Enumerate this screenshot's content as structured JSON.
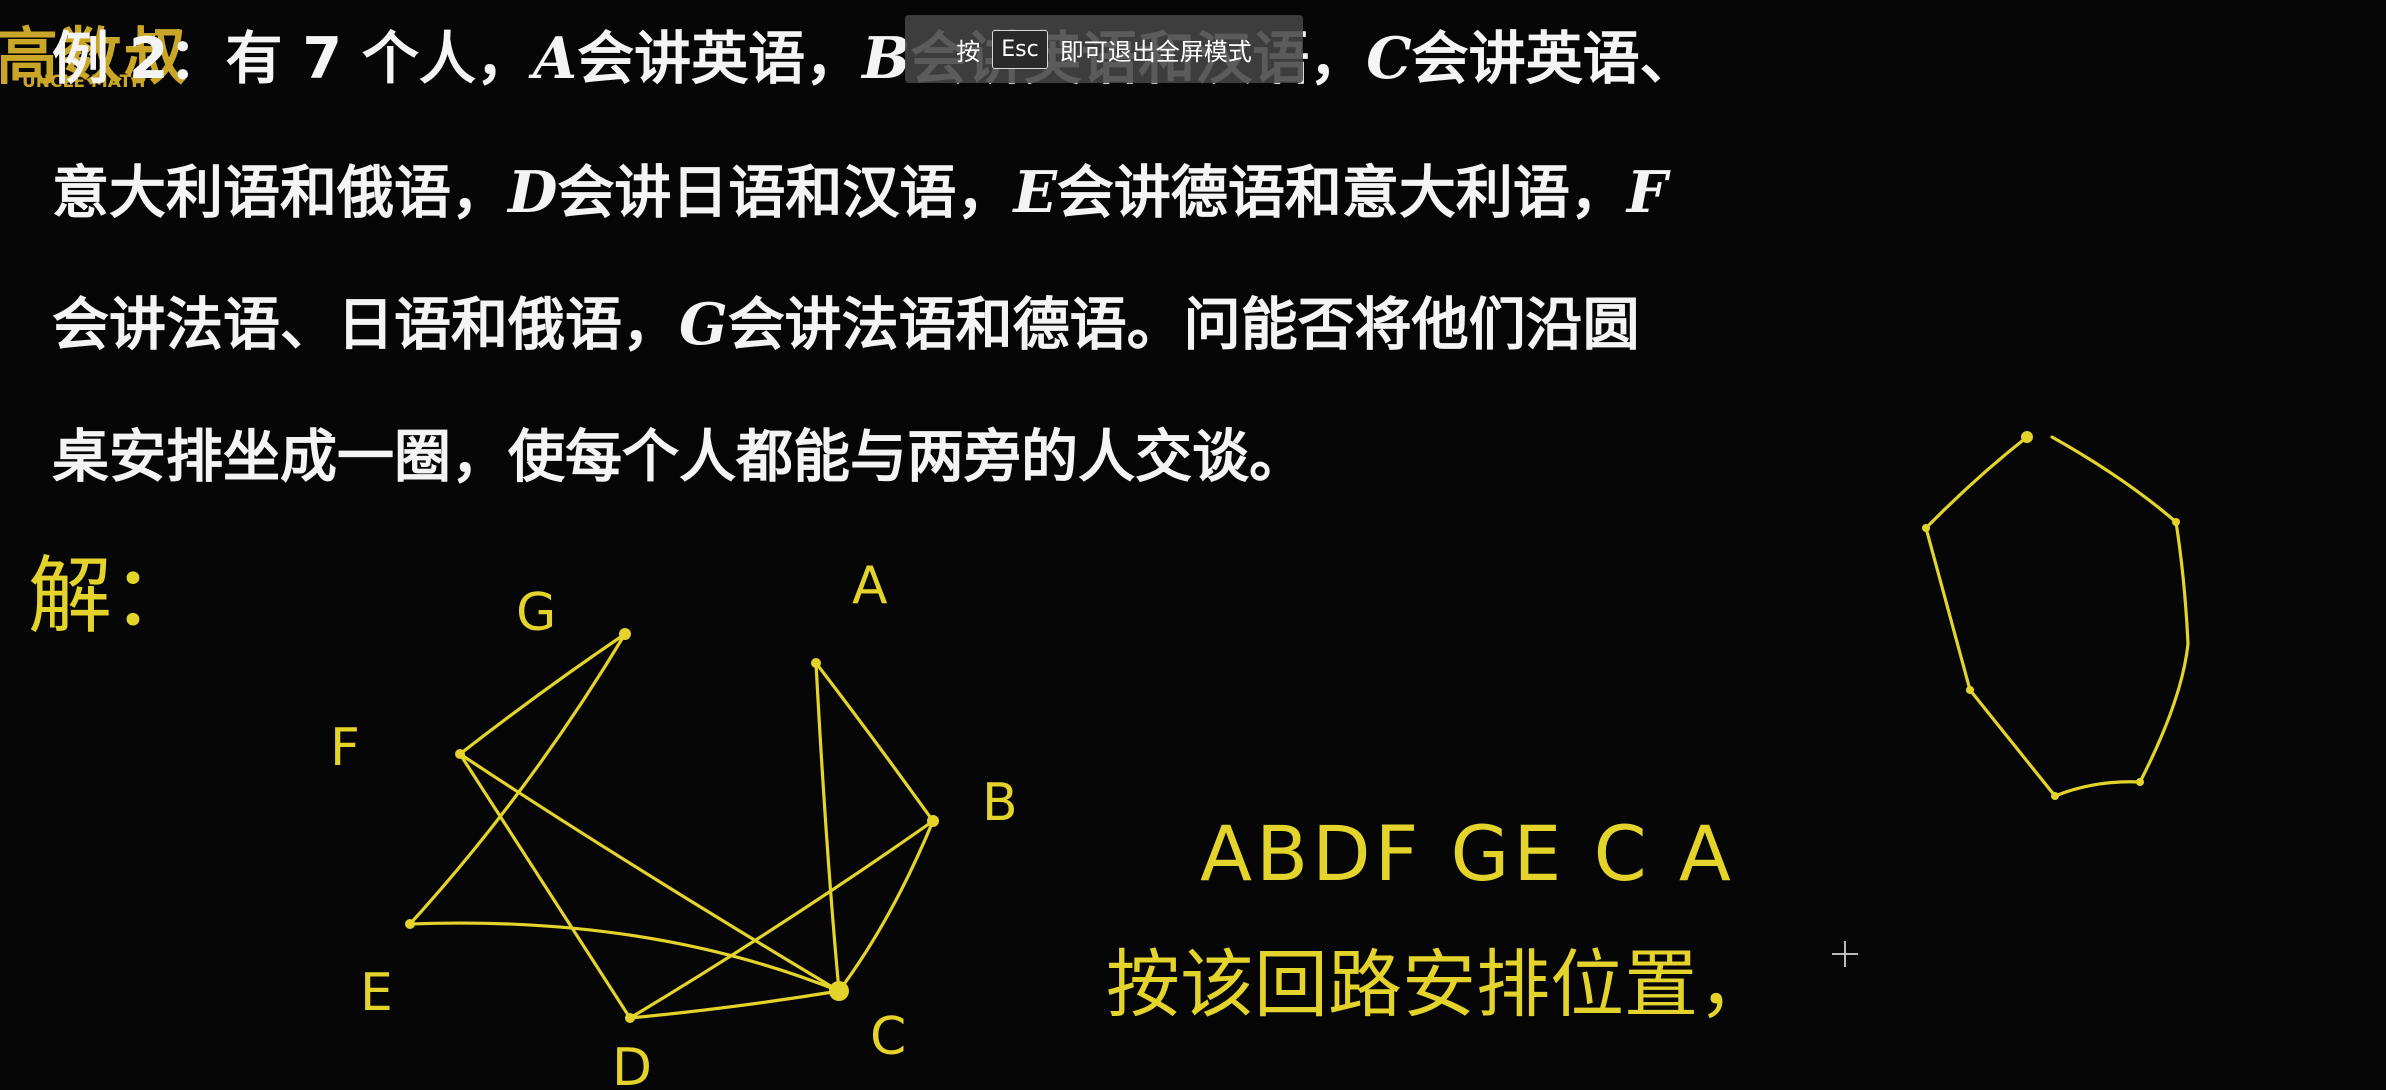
{
  "video": {
    "logo": {
      "text_cn": "高数叔",
      "text_en": "UNCLE MATH"
    },
    "fullscreen_banner": {
      "press": "按",
      "key": "Esc",
      "hint": "即可退出全屏模式"
    },
    "problem": {
      "lines": [
        {
          "parts": [
            {
              "t": "例 2：有 7 个人，"
            },
            {
              "t": "A",
              "v": true
            },
            {
              "t": "会讲英语，"
            },
            {
              "t": "B",
              "v": true
            },
            {
              "t": "会讲英语和汉语，"
            },
            {
              "t": "C",
              "v": true
            },
            {
              "t": "会讲英语、"
            }
          ]
        },
        {
          "parts": [
            {
              "t": "意大利语和俄语，"
            },
            {
              "t": "D",
              "v": true
            },
            {
              "t": "会讲日语和汉语，"
            },
            {
              "t": "E",
              "v": true
            },
            {
              "t": "会讲德语和意大利语，"
            },
            {
              "t": "F",
              "v": true
            }
          ]
        },
        {
          "parts": [
            {
              "t": "会讲法语、日语和俄语，"
            },
            {
              "t": "G",
              "v": true
            },
            {
              "t": "会讲法语和德语。问能否将他们沿圆"
            }
          ]
        },
        {
          "parts": [
            {
              "t": "桌安排坐成一圈，使每个人都能与两旁的人交谈。"
            }
          ]
        }
      ]
    },
    "handwriting": {
      "solution_label": "解：",
      "graph_vertices": [
        "A",
        "B",
        "C",
        "D",
        "E",
        "F",
        "G"
      ],
      "cycle": "ABDF GE C A",
      "conclusion": "按该回路安排位置，"
    },
    "colors": {
      "ink": "#e3d32a",
      "background": "#060606",
      "text": "#f4f4f4"
    }
  }
}
